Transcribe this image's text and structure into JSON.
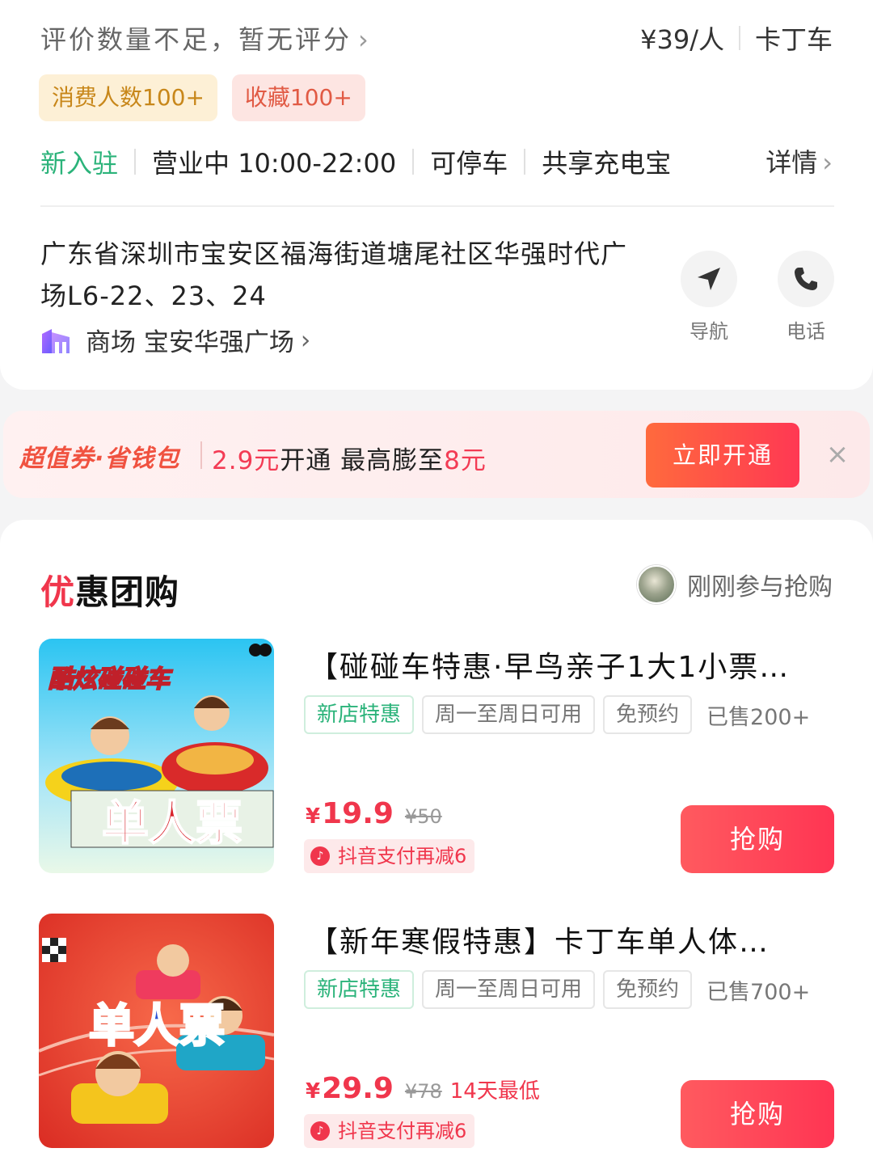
{
  "info": {
    "rating_text": "评价数量不足，暂无评分",
    "price_per_person": "¥39/人",
    "category": "卡丁车",
    "chips": {
      "consumers": "消费人数100+",
      "favorites": "收藏100+"
    },
    "status": {
      "new": "新入驻",
      "hours": "营业中 10:00-22:00",
      "parking": "可停车",
      "powerbank": "共享充电宝",
      "detail": "详情"
    },
    "address": "广东省深圳市宝安区福海街道塘尾社区华强时代广场L6-22、23、24",
    "mall": "商场 宝安华强广场",
    "actions": {
      "navigate": "导航",
      "call": "电话"
    }
  },
  "promo": {
    "brand": "超值券·省钱包",
    "price": "2.9元",
    "open_text": "开通 最高膨至",
    "max_value": "8元",
    "button": "立即开通",
    "close": "×"
  },
  "deals_section": {
    "title_first": "优",
    "title_rest": "惠团购",
    "recent": "刚刚参与抢购",
    "items": [
      {
        "title": "【碰碰车特惠·早鸟亲子1大1小票…",
        "thumb_caption_top": "酷炫碰碰车",
        "thumb_caption_main": "单人票",
        "tags": [
          "新店特惠",
          "周一至周日可用",
          "免预约"
        ],
        "sold": "已售200+",
        "price_symbol": "¥",
        "price": "19.9",
        "original": "¥50",
        "lowest": "",
        "douyin": "抖音支付再减6",
        "button": "抢购"
      },
      {
        "title": "【新年寒假特惠】卡丁车单人体…",
        "thumb_caption_main": "单人票",
        "tags": [
          "新店特惠",
          "周一至周日可用",
          "免预约"
        ],
        "sold": "已售700+",
        "price_symbol": "¥",
        "price": "29.9",
        "original": "¥78",
        "lowest": "14天最低",
        "douyin": "抖音支付再减6",
        "button": "抢购"
      }
    ]
  },
  "colors": {
    "accent_red": "#f0364c",
    "green": "#2bb37a",
    "button_gradient_start": "#ff6a3d",
    "button_gradient_end": "#ff3853"
  },
  "icons": [
    "chevron-right-icon",
    "mall-icon",
    "navigation-icon",
    "phone-icon",
    "close-icon",
    "douyin-icon"
  ]
}
